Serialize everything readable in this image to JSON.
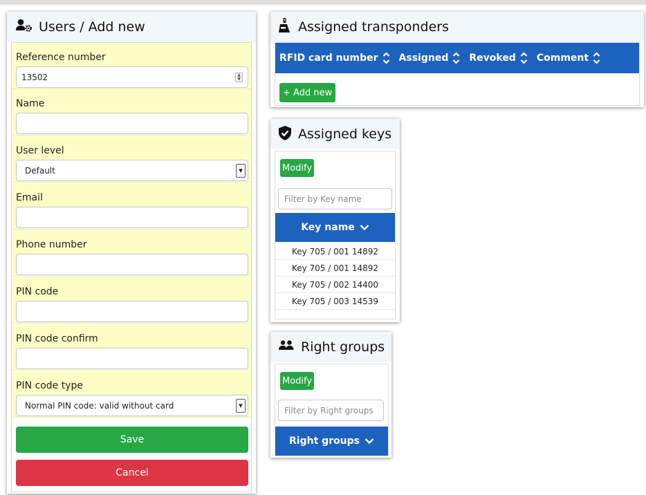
{
  "users": {
    "title": "Users / Add new",
    "icon": "user-cog-icon",
    "fields": {
      "reference": {
        "label": "Reference number",
        "value": "13502"
      },
      "name": {
        "label": "Name",
        "value": ""
      },
      "user_level": {
        "label": "User level",
        "value": "Default"
      },
      "email": {
        "label": "Email",
        "value": ""
      },
      "phone": {
        "label": "Phone number",
        "value": ""
      },
      "pin": {
        "label": "PIN code",
        "value": ""
      },
      "pin_confirm": {
        "label": "PIN code confirm",
        "value": ""
      },
      "pin_type": {
        "label": "PIN code type",
        "value": "Normal PIN code: valid without card"
      }
    },
    "save_label": "Save",
    "cancel_label": "Cancel"
  },
  "transponders": {
    "title": "Assigned transponders",
    "icon": "transponder-icon",
    "columns": [
      "RFID card number",
      "Assigned",
      "Revoked",
      "Comment"
    ],
    "add_label": "+ Add new"
  },
  "keys": {
    "title": "Assigned keys",
    "icon": "shield-check-icon",
    "modify_label": "Modify",
    "filter_placeholder": "Filter by Key name",
    "column": "Key name",
    "rows": [
      "Key 705 / 001 14892",
      "Key 705 / 001 14892",
      "Key 705 / 002 14400",
      "Key 705 / 003 14539"
    ]
  },
  "right_groups": {
    "title": "Right groups",
    "icon": "users-icon",
    "modify_label": "Modify",
    "filter_placeholder": "Filter by Right groups",
    "column": "Right groups"
  },
  "colors": {
    "header_bg": "#f1f6fb",
    "field_bg": "#fdfec6",
    "table_head": "#1e62c0",
    "success": "#28a745",
    "danger": "#dc3545"
  }
}
